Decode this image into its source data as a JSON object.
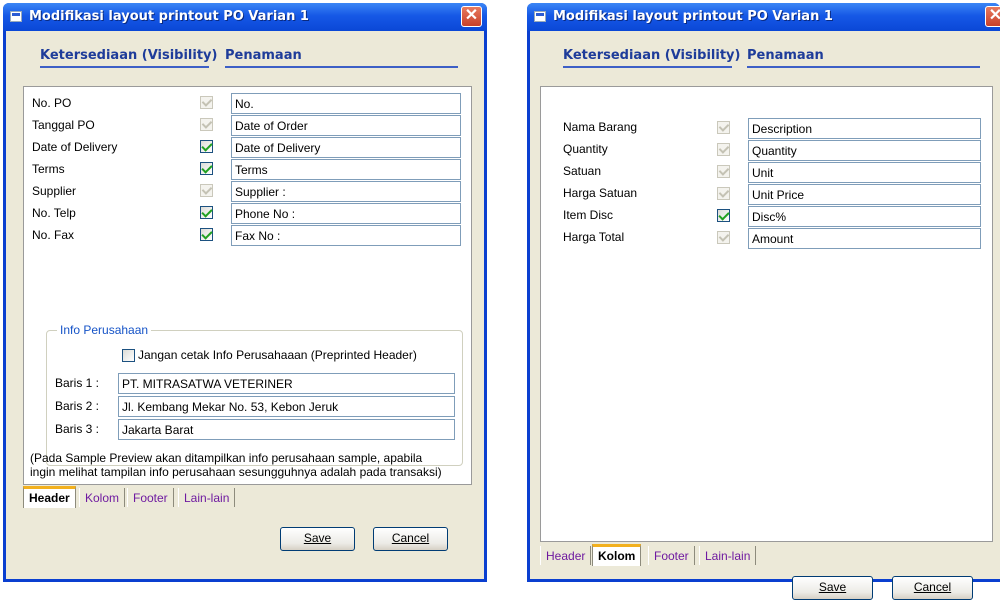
{
  "left_window": {
    "title": "Modifikasi layout printout PO Varian 1",
    "close_glyph": "✕",
    "headers": {
      "visibility": "Ketersediaan (Visibility)",
      "naming": "Penamaan"
    },
    "fields": [
      {
        "label": "No. PO",
        "checked": true,
        "enabled": false,
        "value": "No."
      },
      {
        "label": "Tanggal PO",
        "checked": true,
        "enabled": false,
        "value": "Date of Order"
      },
      {
        "label": "Date of Delivery",
        "checked": true,
        "enabled": true,
        "value": "Date of Delivery"
      },
      {
        "label": "Terms",
        "checked": true,
        "enabled": true,
        "value": "Terms"
      },
      {
        "label": "Supplier",
        "checked": true,
        "enabled": false,
        "value": "Supplier :"
      },
      {
        "label": "No. Telp",
        "checked": true,
        "enabled": true,
        "value": "Phone No :"
      },
      {
        "label": "No. Fax",
        "checked": true,
        "enabled": true,
        "value": "Fax No :"
      }
    ],
    "company_info": {
      "group_label": "Info Perusahaan",
      "no_print_label": "Jangan cetak Info Perusahaaan (Preprinted Header)",
      "no_print_checked": false,
      "lines": [
        {
          "label": "Baris 1 :",
          "value": "PT. MITRASATWA VETERINER"
        },
        {
          "label": "Baris 2 :",
          "value": "Jl. Kembang Mekar No. 53, Kebon Jeruk"
        },
        {
          "label": "Baris 3 :",
          "value": "Jakarta Barat"
        }
      ]
    },
    "note_line1": "(Pada Sample Preview akan ditampilkan info perusahaan sample, apabila",
    "note_line2": "ingin melihat tampilan info perusahaan sesungguhnya adalah pada transaksi)",
    "tabs": [
      "Header",
      "Kolom",
      "Footer",
      "Lain-lain"
    ],
    "active_tab": "Header",
    "save_label": "Save",
    "cancel_label": "Cancel"
  },
  "right_window": {
    "title": "Modifikasi layout printout PO Varian 1",
    "close_glyph": "✕",
    "headers": {
      "visibility": "Ketersediaan (Visibility)",
      "naming": "Penamaan"
    },
    "fields": [
      {
        "label": "Nama Barang",
        "checked": true,
        "enabled": false,
        "value": "Description"
      },
      {
        "label": "Quantity",
        "checked": true,
        "enabled": false,
        "value": "Quantity"
      },
      {
        "label": "Satuan",
        "checked": true,
        "enabled": false,
        "value": "Unit"
      },
      {
        "label": "Harga Satuan",
        "checked": true,
        "enabled": false,
        "value": "Unit Price"
      },
      {
        "label": "Item Disc",
        "checked": true,
        "enabled": true,
        "value": "Disc%"
      },
      {
        "label": "Harga Total",
        "checked": true,
        "enabled": false,
        "value": "Amount"
      }
    ],
    "tabs": [
      "Header",
      "Kolom",
      "Footer",
      "Lain-lain"
    ],
    "active_tab": "Kolom",
    "save_label": "Save",
    "cancel_label": "Cancel"
  },
  "colors": {
    "titlebar": "#0a47d6",
    "dialog_face": "#ece9d8",
    "header_text": "#1e3c9a",
    "active_tab_accent": "#f2b01e",
    "check_green": "#21a121"
  }
}
